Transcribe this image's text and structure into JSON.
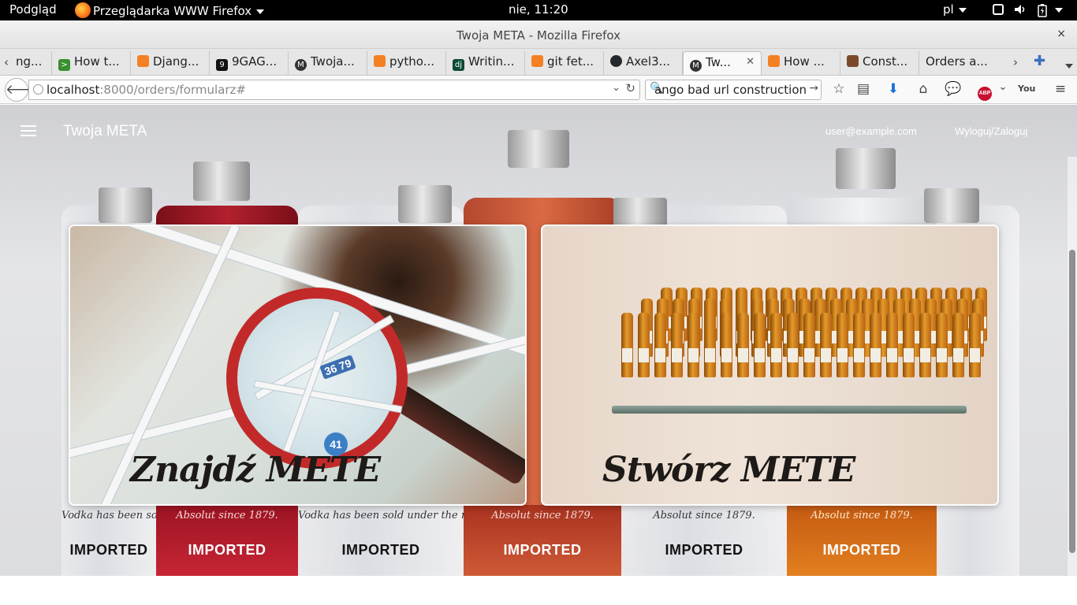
{
  "os_panel": {
    "activities": "Podgląd",
    "app_menu": "Przeglądarka WWW Firefox",
    "clock": "nie, 11:20",
    "keyboard_layout": "pl"
  },
  "window": {
    "title": "Twoja META - Mozilla Firefox",
    "close": "×"
  },
  "tabs": [
    {
      "label": "ng...",
      "icon": "partial-tab"
    },
    {
      "label": "How t...",
      "icon": "terminal-favicon",
      "color": "#3a8f2f"
    },
    {
      "label": "Djang...",
      "icon": "stackoverflow-favicon",
      "color": "#f48024"
    },
    {
      "label": "9GAG...",
      "icon": "9gag-favicon",
      "color": "#111111"
    },
    {
      "label": "Twoja...",
      "icon": "meta-favicon",
      "color": "#333333"
    },
    {
      "label": "pytho...",
      "icon": "stackoverflow-favicon",
      "color": "#f48024"
    },
    {
      "label": "Writin...",
      "icon": "django-favicon",
      "color": "#0c4b33"
    },
    {
      "label": "git fet...",
      "icon": "stackoverflow-favicon",
      "color": "#f48024"
    },
    {
      "label": "Axel3...",
      "icon": "github-favicon",
      "color": "#24292e"
    },
    {
      "label": "Tw...",
      "icon": "meta-favicon",
      "color": "#333333",
      "active": true
    },
    {
      "label": "How ...",
      "icon": "stackoverflow-favicon",
      "color": "#f48024"
    },
    {
      "label": "Const...",
      "icon": "avatar-favicon",
      "color": "#7a4b2a"
    },
    {
      "label": "Orders a...",
      "icon": "none"
    }
  ],
  "navbar": {
    "url_host": "localhost",
    "url_rest": ":8000/orders/formularz#",
    "search_value": "ango bad url construction"
  },
  "site": {
    "title": "Twoja META",
    "user_email": "user@example.com",
    "login_link": "Wyloguj/Zaloguj"
  },
  "cards": {
    "find_title": "Znajdź METE",
    "create_title": "Stwórz METE"
  },
  "decor": {
    "vodka_text": "Vodka has been sold under the name",
    "vodka_text2": "Absolut since 1879.",
    "imported": "IMPORTED",
    "map_badge_1": "36 79",
    "map_badge_2": "41"
  }
}
